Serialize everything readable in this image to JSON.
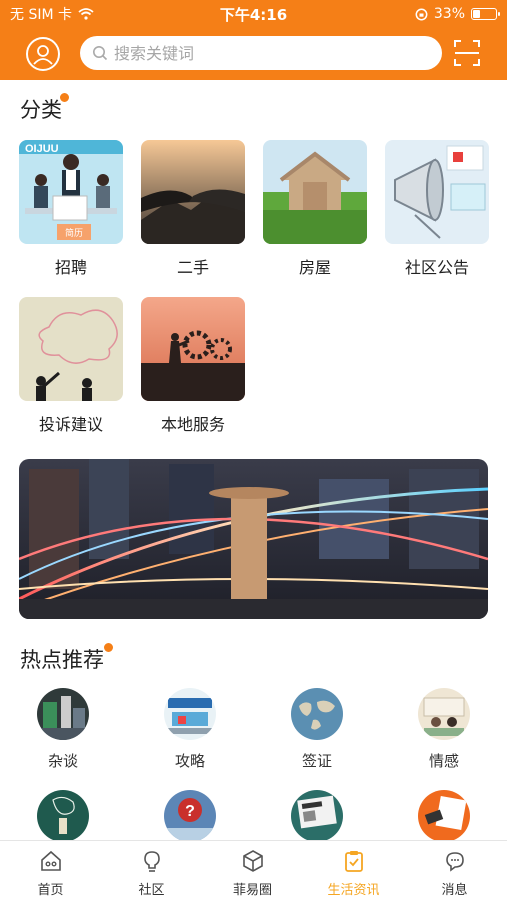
{
  "status": {
    "carrier": "无 SIM 卡",
    "time": "下午4:16",
    "battery": "33%",
    "battery_level": 0.33
  },
  "search": {
    "placeholder": "搜索关键词"
  },
  "categories": {
    "title": "分类",
    "items": [
      {
        "label": "招聘"
      },
      {
        "label": "二手"
      },
      {
        "label": "房屋"
      },
      {
        "label": "社区公告"
      },
      {
        "label": "投诉建议"
      },
      {
        "label": "本地服务"
      }
    ],
    "recruit_badge": "简历"
  },
  "hot": {
    "title": "热点推荐",
    "items": [
      {
        "label": "杂谈"
      },
      {
        "label": "攻略"
      },
      {
        "label": "签证"
      },
      {
        "label": "情感"
      },
      {
        "label": ""
      },
      {
        "label": ""
      },
      {
        "label": ""
      },
      {
        "label": ""
      }
    ]
  },
  "tabbar": {
    "items": [
      {
        "label": "首页",
        "icon": "home-icon"
      },
      {
        "label": "社区",
        "icon": "lightbulb-icon"
      },
      {
        "label": "菲易圈",
        "icon": "cube-icon"
      },
      {
        "label": "生活资讯",
        "icon": "clipboard-check-icon",
        "active": true
      },
      {
        "label": "消息",
        "icon": "chat-bubble-icon"
      }
    ]
  },
  "colors": {
    "brand": "#f57f17",
    "active_tab": "#f5a623"
  }
}
